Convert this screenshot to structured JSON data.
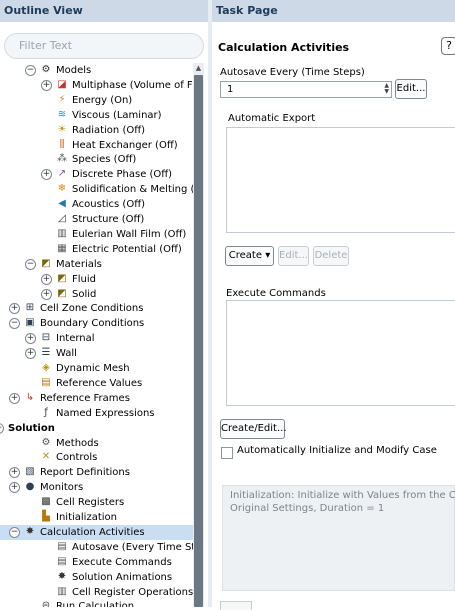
{
  "outline": {
    "header": "Outline View",
    "filter_placeholder": "Filter Text",
    "rows": [
      {
        "label": "Models",
        "toggle": "minus",
        "icon": "gear-icon",
        "glyph": "⚙",
        "color": "#333",
        "indent": 2
      },
      {
        "label": "Multiphase (Volume of Fluid)",
        "toggle": "plus",
        "icon": "multiphase-icon",
        "glyph": "◪",
        "color": "#c0392b",
        "indent": 3
      },
      {
        "label": "Energy (On)",
        "toggle": "",
        "icon": "energy-icon",
        "glyph": "⚡",
        "color": "#e67e22",
        "indent": 3
      },
      {
        "label": "Viscous (Laminar)",
        "toggle": "",
        "icon": "viscous-icon",
        "glyph": "≋",
        "color": "#2e86c1",
        "indent": 3
      },
      {
        "label": "Radiation (Off)",
        "toggle": "",
        "icon": "radiation-icon",
        "glyph": "☀",
        "color": "#b7950b",
        "indent": 3
      },
      {
        "label": "Heat Exchanger (Off)",
        "toggle": "",
        "icon": "heat-exchanger-icon",
        "glyph": "⫼",
        "color": "#d35400",
        "indent": 3
      },
      {
        "label": "Species (Off)",
        "toggle": "",
        "icon": "species-icon",
        "glyph": "⁂",
        "color": "#555",
        "indent": 3
      },
      {
        "label": "Discrete Phase (Off)",
        "toggle": "plus",
        "icon": "discrete-phase-icon",
        "glyph": "↗",
        "color": "#884ea0",
        "indent": 3
      },
      {
        "label": "Solidification & Melting (Off)",
        "toggle": "",
        "icon": "solidification-icon",
        "glyph": "❄",
        "color": "#d68910",
        "indent": 3
      },
      {
        "label": "Acoustics (Off)",
        "toggle": "",
        "icon": "acoustics-icon",
        "glyph": "◀",
        "color": "#2874a6",
        "indent": 3
      },
      {
        "label": "Structure (Off)",
        "toggle": "",
        "icon": "structure-icon",
        "glyph": "◿",
        "color": "#333",
        "indent": 3
      },
      {
        "label": "Eulerian Wall Film (Off)",
        "toggle": "",
        "icon": "wall-film-icon",
        "glyph": "▥",
        "color": "#555",
        "indent": 3
      },
      {
        "label": "Electric Potential (Off)",
        "toggle": "",
        "icon": "electric-potential-icon",
        "glyph": "▦",
        "color": "#555",
        "indent": 3
      },
      {
        "label": "Materials",
        "toggle": "minus",
        "icon": "materials-icon",
        "glyph": "◩",
        "color": "#7d6608",
        "indent": 2
      },
      {
        "label": "Fluid",
        "toggle": "plus",
        "icon": "fluid-icon",
        "glyph": "◩",
        "color": "#7d6608",
        "indent": 3
      },
      {
        "label": "Solid",
        "toggle": "plus",
        "icon": "solid-icon",
        "glyph": "◩",
        "color": "#7d6608",
        "indent": 3
      },
      {
        "label": "Cell Zone Conditions",
        "toggle": "plus",
        "icon": "cell-zone-icon",
        "glyph": "⊞",
        "color": "#2e4053",
        "indent": 1
      },
      {
        "label": "Boundary Conditions",
        "toggle": "minus",
        "icon": "boundary-conditions-icon",
        "glyph": "▣",
        "color": "#2e4053",
        "indent": 1
      },
      {
        "label": "Internal",
        "toggle": "plus",
        "icon": "internal-icon",
        "glyph": "⊟",
        "color": "#2e4053",
        "indent": 2
      },
      {
        "label": "Wall",
        "toggle": "plus",
        "icon": "wall-icon",
        "glyph": "☰",
        "color": "#2e4053",
        "indent": 2
      },
      {
        "label": "Dynamic Mesh",
        "toggle": "",
        "icon": "dynamic-mesh-icon",
        "glyph": "◈",
        "color": "#b7950b",
        "indent": 2
      },
      {
        "label": "Reference Values",
        "toggle": "",
        "icon": "reference-values-icon",
        "glyph": "▤",
        "color": "#b9770e",
        "indent": 2
      },
      {
        "label": "Reference Frames",
        "toggle": "plus",
        "icon": "reference-frames-icon",
        "glyph": "↳",
        "color": "#c0392b",
        "indent": 1
      },
      {
        "label": "Named Expressions",
        "toggle": "",
        "icon": "named-expressions-icon",
        "glyph": "ƒ",
        "color": "#444",
        "indent": 2
      },
      {
        "label": "Solution",
        "toggle": "minus",
        "icon": "",
        "glyph": "",
        "color": "#000",
        "indent": 0,
        "bold": true
      },
      {
        "label": "Methods",
        "toggle": "",
        "icon": "methods-icon",
        "glyph": "⚙",
        "color": "#555",
        "indent": 2
      },
      {
        "label": "Controls",
        "toggle": "",
        "icon": "controls-icon",
        "glyph": "✕",
        "color": "#b7950b",
        "indent": 2
      },
      {
        "label": "Report Definitions",
        "toggle": "plus",
        "icon": "report-definitions-icon",
        "glyph": "▧",
        "color": "#2e4053",
        "indent": 1
      },
      {
        "label": "Monitors",
        "toggle": "plus",
        "icon": "monitors-icon",
        "glyph": "●",
        "color": "#2e4053",
        "indent": 1
      },
      {
        "label": "Cell Registers",
        "toggle": "",
        "icon": "cell-registers-icon",
        "glyph": "▩",
        "color": "#333",
        "indent": 2
      },
      {
        "label": "Initialization",
        "toggle": "",
        "icon": "initialization-icon",
        "glyph": "▙",
        "color": "#b9770e",
        "indent": 2
      },
      {
        "label": "Calculation Activities",
        "toggle": "minus",
        "icon": "calculation-activities-icon",
        "glyph": "✸",
        "color": "#333",
        "indent": 1,
        "selected": true
      },
      {
        "label": "Autosave (Every Time Steps)",
        "toggle": "",
        "icon": "autosave-icon",
        "glyph": "▤",
        "color": "#555",
        "indent": 3
      },
      {
        "label": "Execute Commands",
        "toggle": "",
        "icon": "execute-commands-icon",
        "glyph": "▤",
        "color": "#555",
        "indent": 3
      },
      {
        "label": "Solution Animations",
        "toggle": "",
        "icon": "solution-animations-icon",
        "glyph": "✸",
        "color": "#333",
        "indent": 3
      },
      {
        "label": "Cell Register Operations",
        "toggle": "",
        "icon": "cell-register-ops-icon",
        "glyph": "▥",
        "color": "#555",
        "indent": 3
      },
      {
        "label": "Run Calculation",
        "toggle": "",
        "icon": "run-calculation-icon",
        "glyph": "⊜",
        "color": "#444",
        "indent": 2
      }
    ]
  },
  "task": {
    "header": "Task Page",
    "title": "Calculation Activities",
    "help": "?",
    "autosave_label": "Autosave Every (Time Steps)",
    "autosave_value": "1",
    "edit_label": "Edit...",
    "auto_export_label": "Automatic Export",
    "create_label": "Create",
    "create_arrow": "▾",
    "edit2_label": "Edit...",
    "delete_label": "Delete",
    "execute_label": "Execute Commands",
    "create_edit_label": "Create/Edit...",
    "auto_init_label": "Automatically Initialize and Modify Case",
    "info_line1": "Initialization: Initialize with Values from the Case",
    "info_line2": "Original Settings, Duration = 1"
  }
}
